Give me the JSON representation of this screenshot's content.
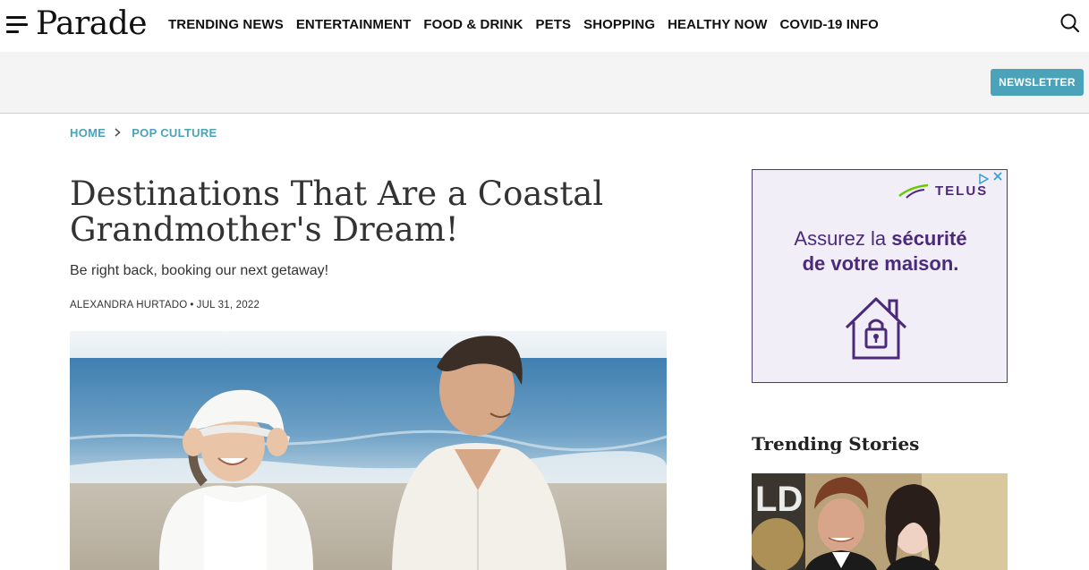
{
  "site": {
    "logo": "Parade"
  },
  "nav": {
    "items": [
      "TRENDING NEWS",
      "ENTERTAINMENT",
      "FOOD & DRINK",
      "PETS",
      "SHOPPING",
      "HEALTHY NOW",
      "COVID-19 INFO"
    ]
  },
  "header": {
    "newsletter_label": "NEWSLETTER"
  },
  "breadcrumb": {
    "home": "HOME",
    "section": "POP CULTURE"
  },
  "article": {
    "title": "Destinations That Are a Coastal Grandmother's Dream!",
    "subtitle": "Be right back, booking our next getaway!",
    "author": "ALEXANDRA HURTADO",
    "date": "JUL 31, 2022"
  },
  "ad": {
    "brand": "TELUS",
    "line1_plain": "Assurez la ",
    "line1_bold": "sécurité",
    "line2": "de votre maison."
  },
  "sidebar": {
    "trending_title": "Trending Stories"
  },
  "colors": {
    "accent": "#4aa3b8",
    "ad_purple": "#4b2a7a",
    "ad_green": "#66cc00"
  }
}
